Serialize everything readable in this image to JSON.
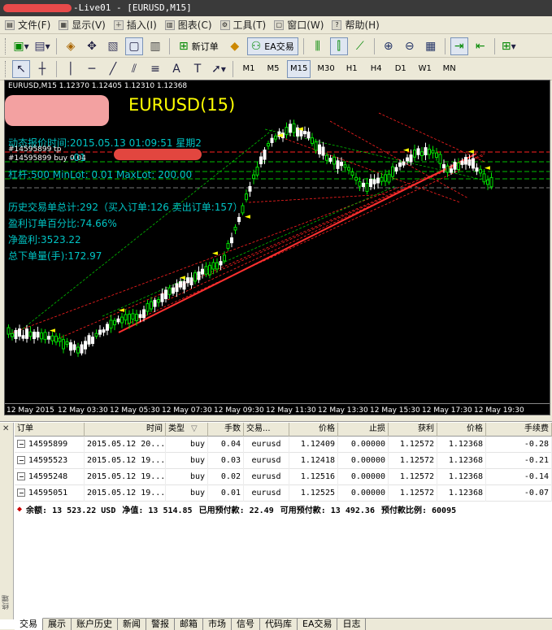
{
  "title_bar": {
    "text": "-Live01 - [EURUSD,M15]"
  },
  "menu": [
    {
      "label": "文件(F)",
      "icon": "file-icon"
    },
    {
      "label": "显示(V)",
      "icon": "view-icon"
    },
    {
      "label": "插入(I)",
      "icon": "insert-icon"
    },
    {
      "label": "图表(C)",
      "icon": "chart-icon"
    },
    {
      "label": "工具(T)",
      "icon": "tools-icon"
    },
    {
      "label": "窗口(W)",
      "icon": "window-icon"
    },
    {
      "label": "帮助(H)",
      "icon": "help-icon"
    }
  ],
  "toolbar1": {
    "new_order": "新订单",
    "ea_trading": "EA交易"
  },
  "timeframes": [
    "M1",
    "M5",
    "M15",
    "M30",
    "H1",
    "H4",
    "D1",
    "W1",
    "MN"
  ],
  "active_timeframe": "M15",
  "chart": {
    "header": "EURUSD,M15  1.12370 1.12405 1.12310 1.12368",
    "title": "EURUSD(15)",
    "quote_time": "动态报价时间:2015.05.13 01:09:51 星期2",
    "ticket_tp": "#14595899 tp",
    "ticket_buy": "#14595899 buy 0.04",
    "account_suffix": "-01",
    "lot_line": "杠杆:500   MinLot:  0.01   MaxLot: 200.00",
    "hist_total": "历史交易单总计:292（买入订单:126  卖出订单:157）",
    "win_rate": "盈利订单百分比:74.66%",
    "net_profit": "净盈利:3523.22",
    "total_volume": "总下单量(手):172.97",
    "x_ticks": [
      "12 May 2015",
      "12 May 03:30",
      "12 May 05:30",
      "12 May 07:30",
      "12 May 09:30",
      "12 May 11:30",
      "12 May 13:30",
      "12 May 15:30",
      "12 May 17:30",
      "12 May 19:30"
    ]
  },
  "colors": {
    "chart_bg": "#000000",
    "bull_candle": "#00e000",
    "bear_candle": "#ffffff",
    "trade_line": "#ff2020",
    "level_line": "#00c000",
    "title_text": "#ffff00",
    "info_text": "#00c4c4"
  },
  "table": {
    "headers": [
      "订单",
      "时间",
      "类型",
      "手数",
      "交易...",
      "价格",
      "止损",
      "获利",
      "价格",
      "手续费"
    ],
    "rows": [
      {
        "order": "14595899",
        "time": "2015.05.12 20...",
        "type": "buy",
        "lots": "0.04",
        "symbol": "eurusd",
        "price": "1.12409",
        "sl": "0.00000",
        "tp": "1.12572",
        "cur_price": "1.12368",
        "commission": "-0.28"
      },
      {
        "order": "14595523",
        "time": "2015.05.12 19...",
        "type": "buy",
        "lots": "0.03",
        "symbol": "eurusd",
        "price": "1.12418",
        "sl": "0.00000",
        "tp": "1.12572",
        "cur_price": "1.12368",
        "commission": "-0.21"
      },
      {
        "order": "14595248",
        "time": "2015.05.12 19...",
        "type": "buy",
        "lots": "0.02",
        "symbol": "eurusd",
        "price": "1.12516",
        "sl": "0.00000",
        "tp": "1.12572",
        "cur_price": "1.12368",
        "commission": "-0.14"
      },
      {
        "order": "14595051",
        "time": "2015.05.12 19...",
        "type": "buy",
        "lots": "0.01",
        "symbol": "eurusd",
        "price": "1.12525",
        "sl": "0.00000",
        "tp": "1.12572",
        "cur_price": "1.12368",
        "commission": "-0.07"
      }
    ]
  },
  "balance": {
    "balance": "余额: 13 523.22 USD",
    "equity": "净值: 13 514.85",
    "margin": "已用预付款: 22.49",
    "free_margin": "可用预付款: 13 492.36",
    "margin_level": "预付款比例: 60095"
  },
  "tabs": [
    "交易",
    "展示",
    "账户历史",
    "新闻",
    "警报",
    "邮箱",
    "市场",
    "信号",
    "代码库",
    "EA交易",
    "日志"
  ],
  "active_tab": "交易",
  "side_label": "终端"
}
